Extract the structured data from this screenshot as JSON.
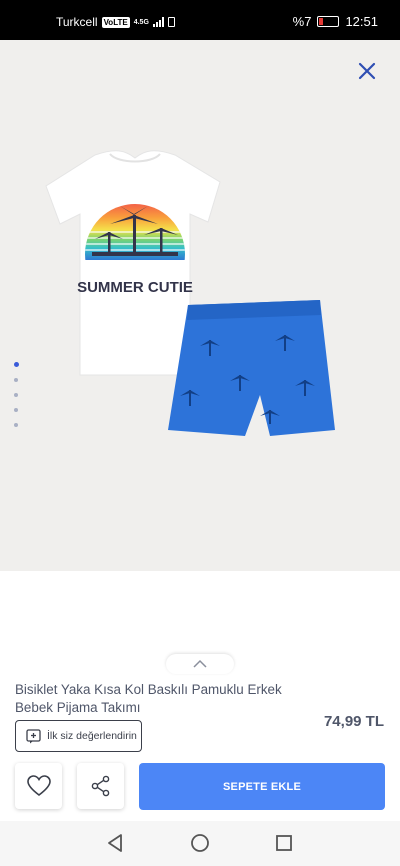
{
  "status_bar": {
    "carrier": "Turkcell",
    "volte": "VoLTE",
    "network": "4.5G",
    "battery": "%7",
    "time": "12:51"
  },
  "gallery": {
    "image_text": "SUMMER CUTIE",
    "slides": 5,
    "active_slide": 1
  },
  "product": {
    "title": "Bisiklet Yaka Kısa Kol Baskılı Pamuklu Erkek Bebek Pijama Takımı",
    "price": "74,99 TL",
    "review_label": "İlk siz değerlendirin"
  },
  "actions": {
    "add_to_cart": "SEPETE EKLE"
  },
  "colors": {
    "primary": "#4c86f6",
    "text": "#4f5669",
    "background": "#f0efed"
  }
}
